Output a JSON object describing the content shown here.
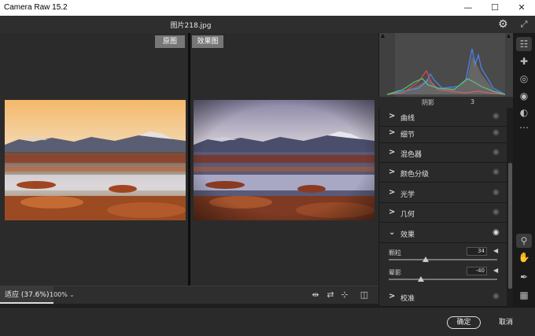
{
  "window": {
    "title": "Camera Raw 15.2",
    "minimize": "—",
    "maximize": "☐",
    "close": "✕"
  },
  "header": {
    "filename": "图片218.jpg",
    "settings_icon": "gear-icon",
    "expand_icon": "expand-icon"
  },
  "preview": {
    "before_label": "原图",
    "after_label": "效果图"
  },
  "zoom": {
    "fit_label": "适应 (37.6%)",
    "level": "100%",
    "caret": "⌄"
  },
  "histogram": {
    "label": "阴影",
    "value": "3"
  },
  "panels": {
    "curve": "曲线",
    "detail": "细节",
    "mixer": "混色器",
    "color_grading": "颜色分级",
    "optics": "光学",
    "geometry": "几何",
    "effects": "效果",
    "calibration": "校准"
  },
  "effects": {
    "grain": {
      "label": "颗粒",
      "value": "34",
      "fraction": 0.34
    },
    "vignette": {
      "label": "晕影",
      "value": "-40",
      "fraction": 0.3
    }
  },
  "buttons": {
    "ok": "确定",
    "cancel": "取消"
  },
  "tools": [
    "edit-icon",
    "heal-icon",
    "mask-icon",
    "redeye-icon",
    "presets-icon",
    "more-icon",
    "zoom-icon",
    "hand-icon",
    "sampler-icon",
    "grid-icon"
  ]
}
